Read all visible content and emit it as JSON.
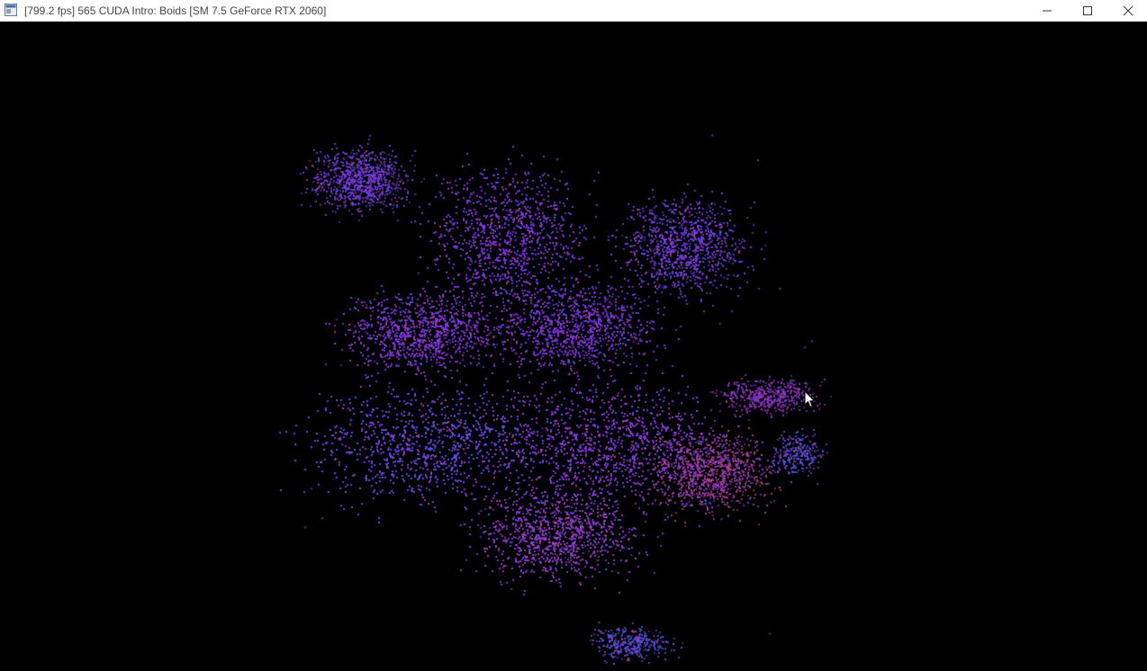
{
  "window": {
    "title": "[799.2 fps] 565 CUDA Intro: Boids [SM 7.5 GeForce RTX 2060]",
    "icon": "app-window-icon",
    "controls": {
      "minimize": "minimize-icon",
      "maximize": "maximize-icon",
      "close": "close-icon"
    }
  },
  "viewport": {
    "background": "#000000",
    "particle_colors": [
      "#7a2fe0",
      "#8a35e8",
      "#5a4ce8",
      "#6d3ee6",
      "#9b3fd0",
      "#4a5ae0",
      "#b0408a",
      "#8e2fb8"
    ],
    "cursor": "mouse-pointer-icon"
  }
}
